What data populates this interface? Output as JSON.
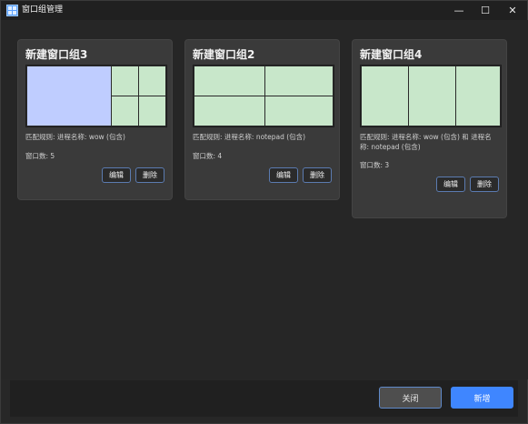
{
  "window": {
    "title": "窗口组管理",
    "controls": {
      "minimize": "—",
      "maximize": "☐",
      "close": "✕"
    }
  },
  "groups": [
    {
      "title": "新建窗口组3",
      "rule": "匹配规则: 进程名称: wow (包含)",
      "count": "窗口数: 5",
      "edit": "编辑",
      "delete": "删除"
    },
    {
      "title": "新建窗口组2",
      "rule": "匹配规则: 进程名称: notepad (包含)",
      "count": "窗口数: 4",
      "edit": "编辑",
      "delete": "删除"
    },
    {
      "title": "新建窗口组4",
      "rule_line1": "匹配规则: 进程名称: wow (包含) 和 进程名",
      "rule_line2": "称: notepad (包含)",
      "count": "窗口数: 3",
      "edit": "编辑",
      "delete": "删除"
    }
  ],
  "footer": {
    "close_label": "关闭",
    "new_label": "新增"
  },
  "colors": {
    "accent": "#3f86ff",
    "cell_green": "#c8e7ca",
    "cell_blue": "#bfcdff"
  }
}
